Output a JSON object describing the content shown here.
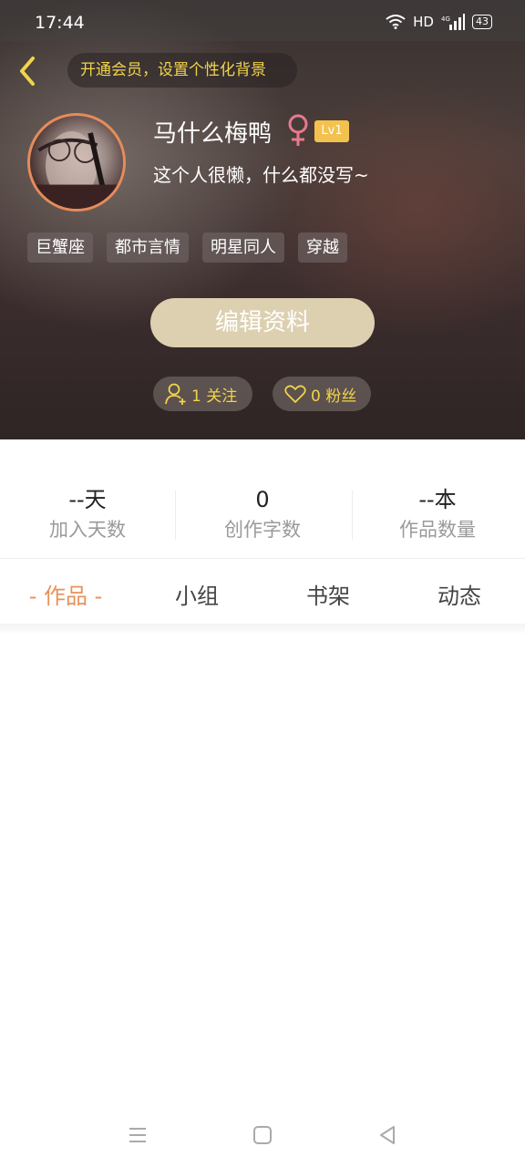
{
  "status_bar": {
    "time": "17:44",
    "network": "HD",
    "signal_label": "4G",
    "battery": "43"
  },
  "header": {
    "vip_prompt": "开通会员，设置个性化背景",
    "username": "马什么梅鸭",
    "level": "Lv1",
    "bio": "这个人很懒，什么都没写~",
    "tags": [
      "巨蟹座",
      "都市言情",
      "明星同人",
      "穿越"
    ],
    "edit_button": "编辑资料",
    "follow": "1 关注",
    "fans": "0 粉丝"
  },
  "stats": [
    {
      "value": "--天",
      "label": "加入天数"
    },
    {
      "value": "0",
      "label": "创作字数"
    },
    {
      "value": "--本",
      "label": "作品数量"
    }
  ],
  "tabs": [
    "- 作品 -",
    "小组",
    "书架",
    "动态"
  ],
  "colors": {
    "accent": "#e8915c",
    "gold_text": "#f2d44a",
    "level_badge": "#f3c24e",
    "gender_female": "#e57a8e",
    "edit_button_bg": "#ddd0b1"
  },
  "icons": {
    "back": "chevron-left-icon",
    "gender": "female-icon",
    "follow": "add-user-icon",
    "fans": "heart-icon",
    "nav": [
      "menu-icon",
      "home-square-icon",
      "back-triangle-icon"
    ]
  }
}
